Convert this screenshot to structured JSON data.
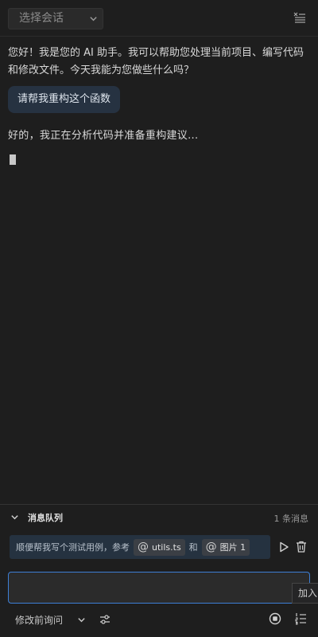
{
  "header": {
    "session_select": "选择会话"
  },
  "chat": {
    "messages": [
      {
        "role": "assistant",
        "text": "您好！我是您的 AI 助手。我可以帮助您处理当前项目、编写代码和修改文件。今天我能为您做些什么吗？"
      },
      {
        "role": "user",
        "text": "请帮我重构这个函数"
      },
      {
        "role": "assistant",
        "text": "好的，我正在分析代码并准备重构建议..."
      }
    ]
  },
  "queue": {
    "title": "消息队列",
    "count": "1 条消息",
    "item": {
      "prefix": "顺便帮我写个测试用例，参考",
      "chip1": "utils.ts",
      "connector": "和",
      "chip2": "图片 1",
      "at_symbol": "@"
    }
  },
  "input": {
    "value": "",
    "placeholder": ""
  },
  "tooltip": "加入",
  "footer": {
    "mode": "修改前询问"
  },
  "colors": {
    "accent": "#3d7fd6",
    "bubble": "#263241",
    "background": "#1e1e1e",
    "queue_item": "#253240"
  },
  "icons": [
    "chevron-down-icon",
    "menu-list-icon",
    "play-icon",
    "trash-icon",
    "sliders-icon",
    "stop-circle-icon",
    "numbered-list-icon"
  ]
}
